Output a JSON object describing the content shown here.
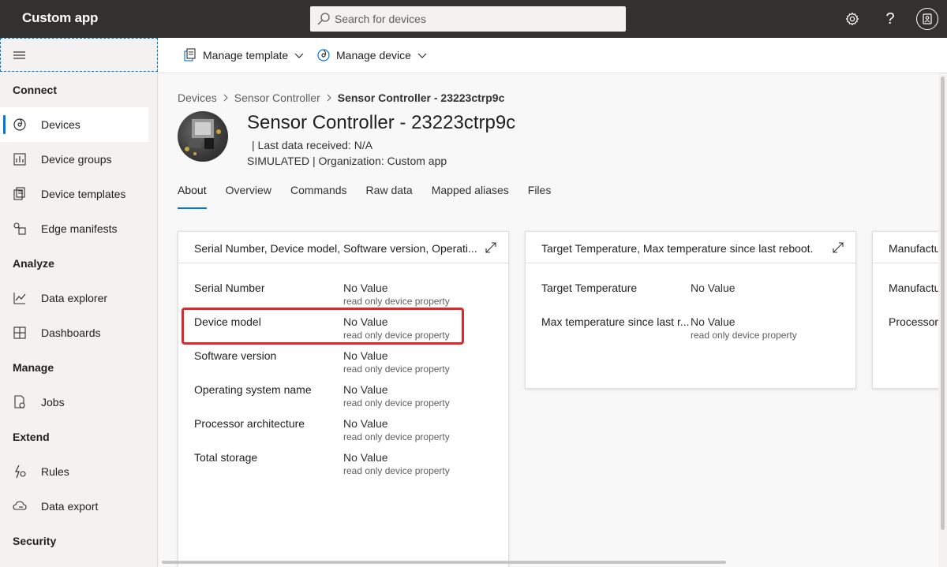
{
  "app": {
    "title": "Custom app"
  },
  "search": {
    "placeholder": "Search for devices"
  },
  "sidebar": {
    "sections": [
      {
        "label": "Connect"
      },
      {
        "label": "Analyze"
      },
      {
        "label": "Manage"
      },
      {
        "label": "Extend"
      },
      {
        "label": "Security"
      }
    ],
    "items": [
      {
        "label": "Devices",
        "icon": "devices-icon",
        "active": true
      },
      {
        "label": "Device groups",
        "icon": "device-groups-icon"
      },
      {
        "label": "Device templates",
        "icon": "device-templates-icon"
      },
      {
        "label": "Edge manifests",
        "icon": "edge-manifests-icon"
      },
      {
        "label": "Data explorer",
        "icon": "data-explorer-icon"
      },
      {
        "label": "Dashboards",
        "icon": "dashboards-icon"
      },
      {
        "label": "Jobs",
        "icon": "jobs-icon"
      },
      {
        "label": "Rules",
        "icon": "rules-icon"
      },
      {
        "label": "Data export",
        "icon": "data-export-icon"
      }
    ]
  },
  "commandbar": {
    "manage_template": "Manage template",
    "manage_device": "Manage device"
  },
  "breadcrumb": {
    "items": [
      "Devices",
      "Sensor Controller",
      "Sensor Controller - 23223ctrp9c"
    ]
  },
  "device": {
    "title": "Sensor Controller - 23223ctrp9c",
    "last_data": "|  Last data received: N/A",
    "meta": "SIMULATED  |  Organization: Custom app"
  },
  "tabs": [
    {
      "label": "About",
      "active": true
    },
    {
      "label": "Overview"
    },
    {
      "label": "Commands"
    },
    {
      "label": "Raw data"
    },
    {
      "label": "Mapped aliases"
    },
    {
      "label": "Files"
    }
  ],
  "cards": [
    {
      "title": "Serial Number, Device model, Software version, Operating system name, Processor architecture, Total storage",
      "title_display": "Serial Number, Device model, Software version, Operati...",
      "properties": [
        {
          "name": "Serial Number",
          "value": "No Value",
          "note": "read only device property"
        },
        {
          "name": "Device model",
          "value": "No Value",
          "note": "read only device property"
        },
        {
          "name": "Software version",
          "value": "No Value",
          "note": "read only device property"
        },
        {
          "name": "Operating system name",
          "value": "No Value",
          "note": "read only device property"
        },
        {
          "name": "Processor architecture",
          "value": "No Value",
          "note": "read only device property"
        },
        {
          "name": "Total storage",
          "value": "No Value",
          "note": "read only device property"
        }
      ]
    },
    {
      "title": "Target Temperature, Max temperature since last reboot.",
      "properties": [
        {
          "name": "Target Temperature",
          "value": "No Value",
          "note": ""
        },
        {
          "name": "Max temperature since last r...",
          "value": "No Value",
          "note": "read only device property"
        }
      ]
    },
    {
      "title": "Manufactu",
      "properties": [
        {
          "name": "Manufactu"
        },
        {
          "name": "Processor"
        }
      ]
    }
  ],
  "colors": {
    "accent": "#0078d4",
    "topbar": "#323130",
    "highlight": "#d92b2b"
  }
}
